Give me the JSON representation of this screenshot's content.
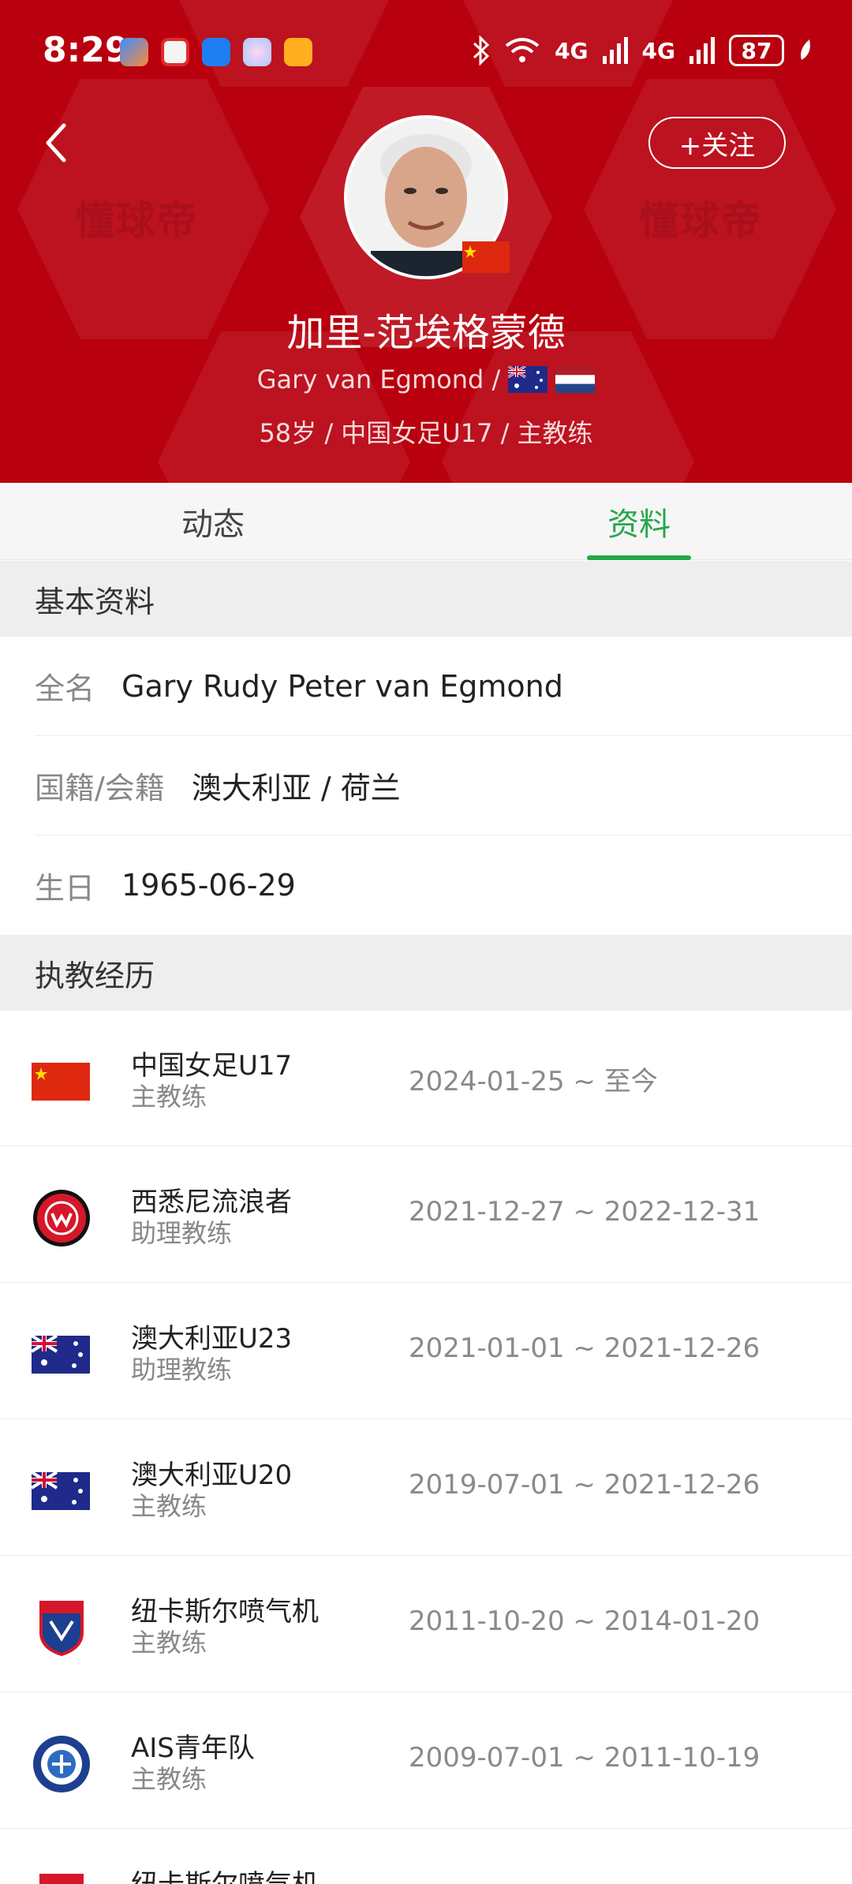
{
  "status_bar": {
    "time": "8:29",
    "battery": "87",
    "signal1": "4G",
    "signal2": "4G"
  },
  "header": {
    "follow_label": "+关注",
    "watermark": "懂球帝",
    "name_cn": "加里-范埃格蒙德",
    "name_en": "Gary van Egmond /",
    "meta": "58岁 / 中国女足U17 / 主教练"
  },
  "tabs": [
    {
      "label": "动态",
      "active": false
    },
    {
      "label": "资料",
      "active": true
    }
  ],
  "basic_info": {
    "title": "基本资料",
    "rows": [
      {
        "label": "全名",
        "value": "Gary Rudy Peter van Egmond"
      },
      {
        "label": "国籍/会籍",
        "value": "澳大利亚 / 荷兰"
      },
      {
        "label": "生日",
        "value": "1965-06-29"
      }
    ]
  },
  "career": {
    "title": "执教经历",
    "items": [
      {
        "team": "中国女足U17",
        "role": "主教练",
        "dates": "2024-01-25 ~ 至今",
        "logo": "china-flag-icon"
      },
      {
        "team": "西悉尼流浪者",
        "role": "助理教练",
        "dates": "2021-12-27 ~ 2022-12-31",
        "logo": "wanderers-badge-icon"
      },
      {
        "team": "澳大利亚U23",
        "role": "助理教练",
        "dates": "2021-01-01 ~ 2021-12-26",
        "logo": "australia-flag-icon"
      },
      {
        "team": "澳大利亚U20",
        "role": "主教练",
        "dates": "2019-07-01 ~ 2021-12-26",
        "logo": "australia-flag-icon"
      },
      {
        "team": "纽卡斯尔喷气机",
        "role": "主教练",
        "dates": "2011-10-20 ~ 2014-01-20",
        "logo": "jets-badge-icon"
      },
      {
        "team": "AIS青年队",
        "role": "主教练",
        "dates": "2009-07-01 ~ 2011-10-19",
        "logo": "ais-badge-icon"
      },
      {
        "team": "纽卡斯尔喷气机",
        "role": "",
        "dates": "",
        "logo": "jets-badge-icon"
      }
    ]
  },
  "colors": {
    "header_red": "#b8000e",
    "accent_green": "#27a64a"
  }
}
